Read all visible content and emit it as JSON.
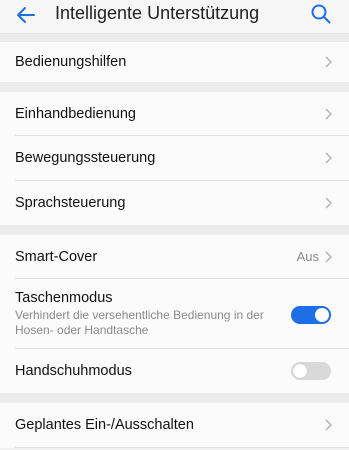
{
  "header": {
    "title": "Intelligente Unterstützung"
  },
  "sections": {
    "s1": {
      "bedienungshilfen": "Bedienungshilfen"
    },
    "s2": {
      "einhand": "Einhandbedienung",
      "bewegung": "Bewegungssteuerung",
      "sprache": "Sprachsteuerung"
    },
    "s3": {
      "smartcover": {
        "label": "Smart-Cover",
        "value": "Aus"
      },
      "tasche": {
        "label": "Taschenmodus",
        "description": "Verhindert die versehentliche Bedienung in der Hosen- oder Handtasche",
        "enabled": true
      },
      "handschuh": {
        "label": "Handschuhmodus",
        "enabled": false
      }
    },
    "s4": {
      "geplant": "Geplantes Ein-/Ausschalten"
    }
  },
  "colors": {
    "accent": "#1e6fe6",
    "toggle_off": "#d9d9d9"
  }
}
